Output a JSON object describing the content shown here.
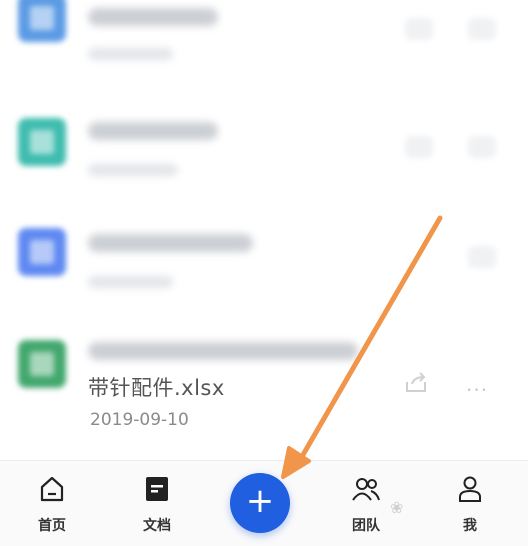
{
  "file_list": {
    "visible_file": {
      "name": "带针配件.xlsx",
      "date": "2019-09-10",
      "more_label": "···"
    },
    "rows": [
      {
        "icon_color": "#4a90e2"
      },
      {
        "icon_color": "#2bb5a6"
      },
      {
        "icon_color": "#4e7df0"
      },
      {
        "icon_color": "#2e9e5e"
      }
    ]
  },
  "tabbar": {
    "home_label": "首页",
    "docs_label": "文档",
    "add_label": "+",
    "team_label": "团队",
    "me_label": "我",
    "fab_color": "#1f5fe0"
  },
  "annotation": {
    "arrow_color": "#f0954a"
  }
}
